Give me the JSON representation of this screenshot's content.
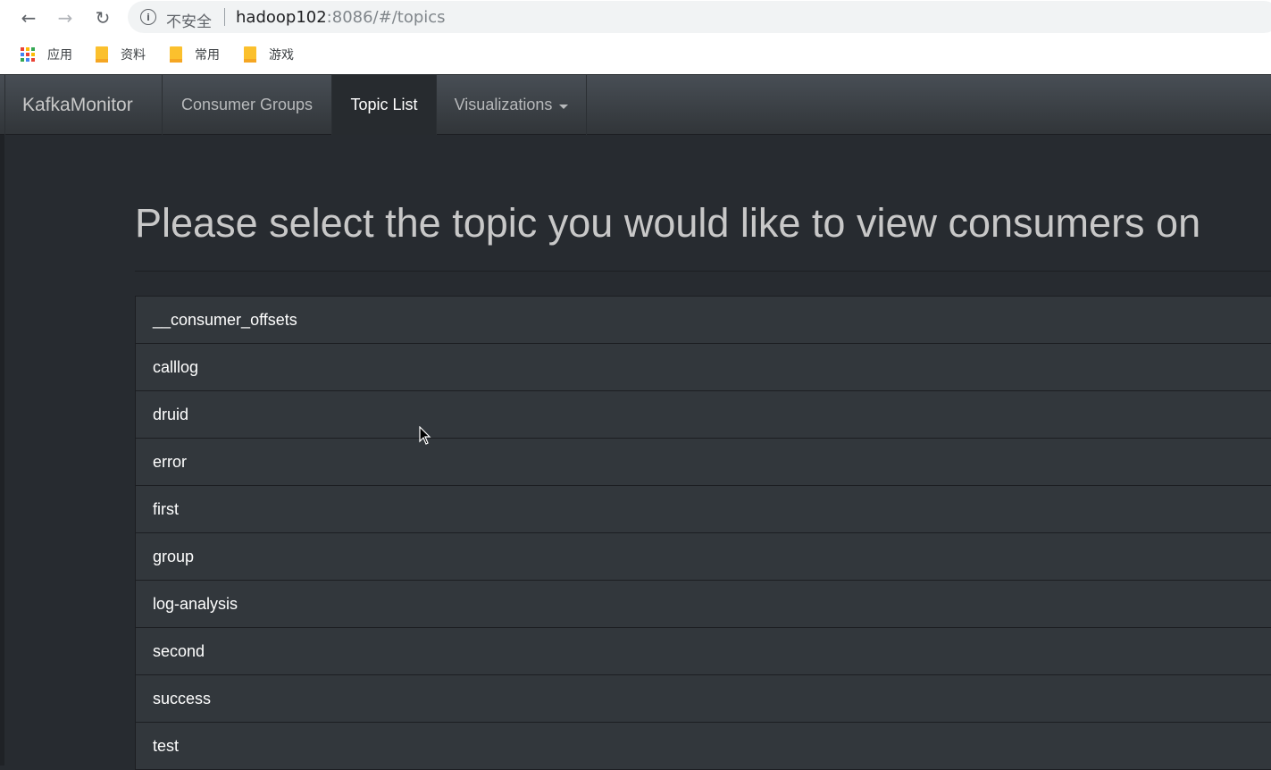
{
  "browser": {
    "security_label": "不安全",
    "url_host": "hadoop102",
    "url_rest": ":8086/#/topics",
    "bookmarks": [
      {
        "label": "应用",
        "icon": "apps-grid-icon"
      },
      {
        "label": "资料",
        "icon": "folder-icon"
      },
      {
        "label": "常用",
        "icon": "folder-icon"
      },
      {
        "label": "游戏",
        "icon": "folder-icon"
      }
    ]
  },
  "navbar": {
    "brand": "KafkaMonitor",
    "items": [
      {
        "label": "Consumer Groups",
        "active": false
      },
      {
        "label": "Topic List",
        "active": true
      },
      {
        "label": "Visualizations",
        "active": false,
        "dropdown": true
      }
    ]
  },
  "main": {
    "title": "Please select the topic you would like to view consumers on",
    "topics": [
      "__consumer_offsets",
      "calllog",
      "druid",
      "error",
      "first",
      "group",
      "log-analysis",
      "second",
      "success",
      "test"
    ]
  },
  "colors": {
    "navbar": "#3a3f44",
    "page_background": "#272b30",
    "list_item": "#32373c",
    "active_nav": "#272b2f"
  }
}
